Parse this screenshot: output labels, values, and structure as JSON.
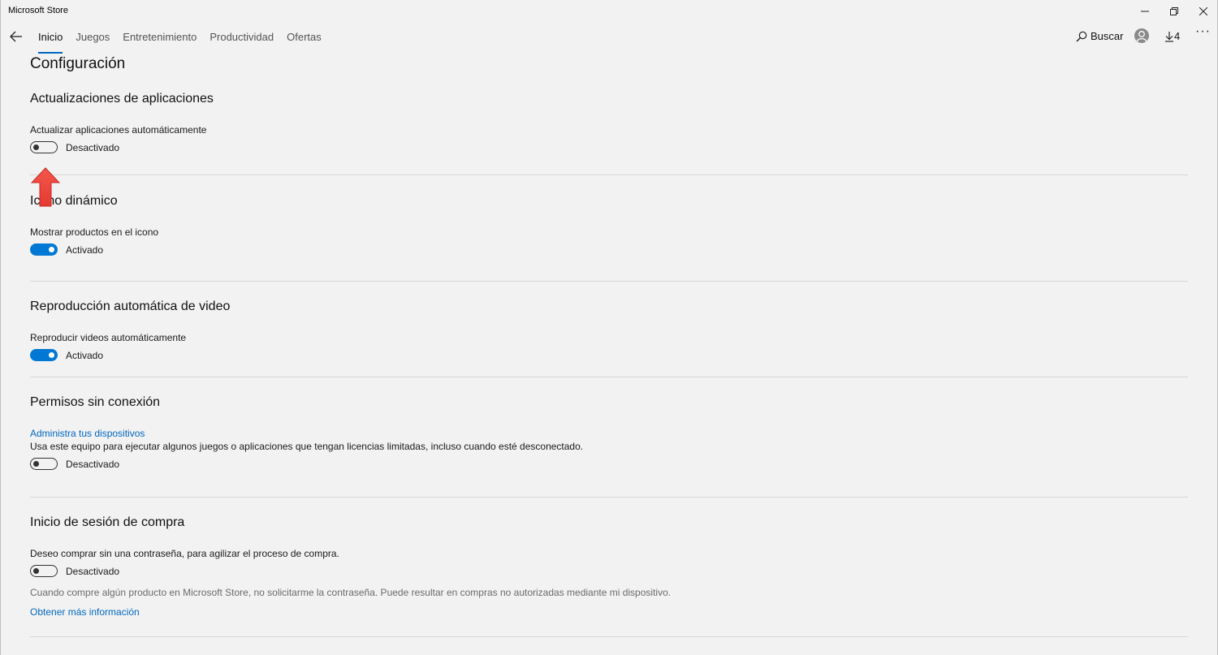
{
  "window": {
    "title": "Microsoft Store"
  },
  "nav": {
    "tabs": [
      {
        "label": "Inicio"
      },
      {
        "label": "Juegos"
      },
      {
        "label": "Entretenimiento"
      },
      {
        "label": "Productividad"
      },
      {
        "label": "Ofertas"
      }
    ],
    "active_tab": "Inicio",
    "search_label": "Buscar",
    "downloads_count": "4"
  },
  "page": {
    "title": "Configuración",
    "sections": [
      {
        "heading": "Actualizaciones de aplicaciones",
        "label": "Actualizar aplicaciones automáticamente",
        "state": "Desactivado",
        "on": false
      },
      {
        "heading": "Icono dinámico",
        "label": "Mostrar productos en el icono",
        "state": "Activado",
        "on": true
      },
      {
        "heading": "Reproducción automática de video",
        "label": "Reproducir videos automáticamente",
        "state": "Activado",
        "on": true
      },
      {
        "heading": "Permisos sin conexión",
        "link": "Administra tus dispositivos",
        "label": "Usa este equipo para ejecutar algunos juegos o aplicaciones que tengan licencias limitadas, incluso cuando esté desconectado.",
        "state": "Desactivado",
        "on": false
      },
      {
        "heading": "Inicio de sesión de compra",
        "label": "Deseo comprar sin una contraseña, para agilizar el proceso de compra.",
        "state": "Desactivado",
        "on": false,
        "note": "Cuando compre algún producto en Microsoft Store, no solicitarme la contraseña. Puede resultar en compras no autorizadas mediante mi dispositivo.",
        "more_link": "Obtener más información"
      }
    ]
  },
  "colors": {
    "accent": "#0078d4",
    "link": "#0067c0",
    "annotation_arrow": "#f0443b"
  }
}
